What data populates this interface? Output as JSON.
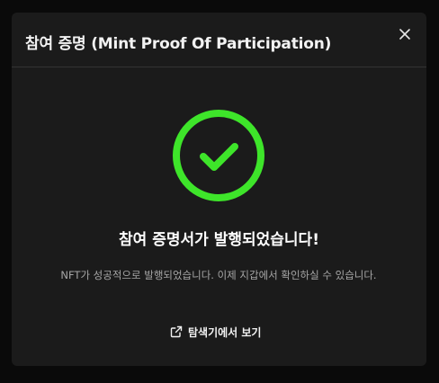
{
  "modal": {
    "title": "참여 증명 (Mint Proof Of Participation)",
    "close_icon": "close-icon",
    "status_icon": "check-circle-icon",
    "headline": "참여 증명서가 발행되었습니다!",
    "description": "NFT가 성공적으로 발행되었습니다. 이제 지갑에서 확인하실 수 있습니다.",
    "link_icon": "external-link-icon",
    "link_label": "탐색기에서 보기"
  },
  "colors": {
    "background": "#0a0a0a",
    "modal_background": "#1b1b1b",
    "divider": "#333333",
    "success": "#3ee52a",
    "title_text": "#f2f2f2",
    "muted_text": "#a6a6a6"
  }
}
